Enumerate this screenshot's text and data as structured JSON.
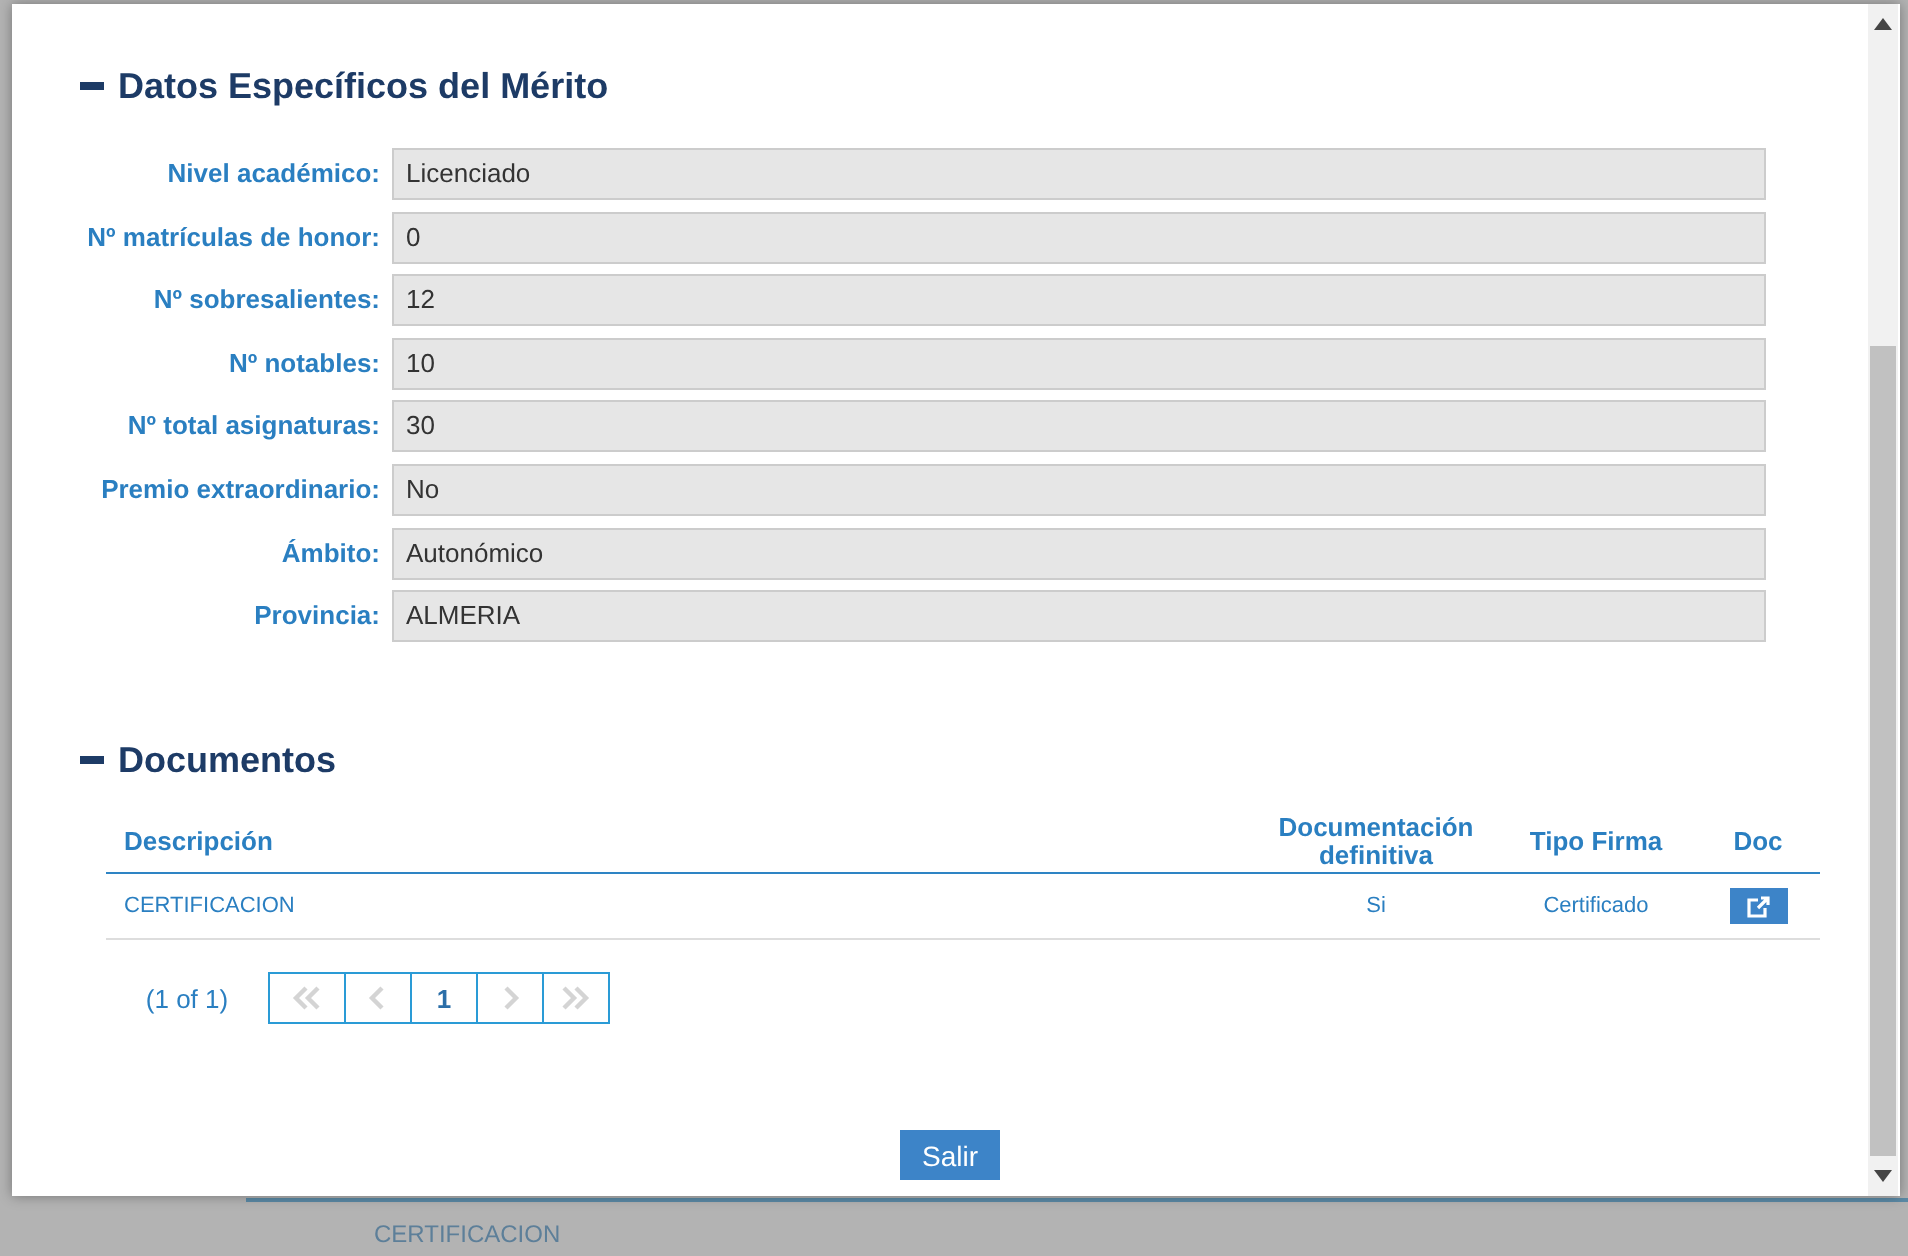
{
  "background": {
    "texts": [
      "CERTIFICACION"
    ]
  },
  "dialog": {
    "sections": [
      {
        "title": "Datos Específicos del Mérito",
        "expanded": true,
        "fields": [
          {
            "label": "Nivel académico:",
            "value": "Licenciado"
          },
          {
            "label": "Nº matrículas de honor:",
            "value": "0"
          },
          {
            "label": "Nº sobresalientes:",
            "value": "12"
          },
          {
            "label": "Nº notables:",
            "value": "10"
          },
          {
            "label": "Nº total asignaturas:",
            "value": "30"
          },
          {
            "label": "Premio extraordinario:",
            "value": "No"
          },
          {
            "label": "Ámbito:",
            "value": "Autonómico"
          },
          {
            "label": "Provincia:",
            "value": "ALMERIA"
          }
        ]
      },
      {
        "title": "Documentos",
        "expanded": true,
        "table": {
          "columns": [
            "Descripción",
            "Documentación definitiva",
            "Tipo Firma",
            "Doc"
          ],
          "rows": [
            {
              "cells": [
                "CERTIFICACION",
                "Si",
                "Certificado"
              ]
            }
          ]
        },
        "paginator": {
          "summary": "(1 of 1)",
          "controls": [
            {
              "kind": "first",
              "disabled": true
            },
            {
              "kind": "prev",
              "disabled": true
            },
            {
              "kind": "page",
              "label": "1",
              "selected": true
            },
            {
              "kind": "next",
              "disabled": true
            },
            {
              "kind": "last",
              "disabled": true
            }
          ]
        }
      }
    ],
    "buttons": [
      "Salir"
    ]
  }
}
